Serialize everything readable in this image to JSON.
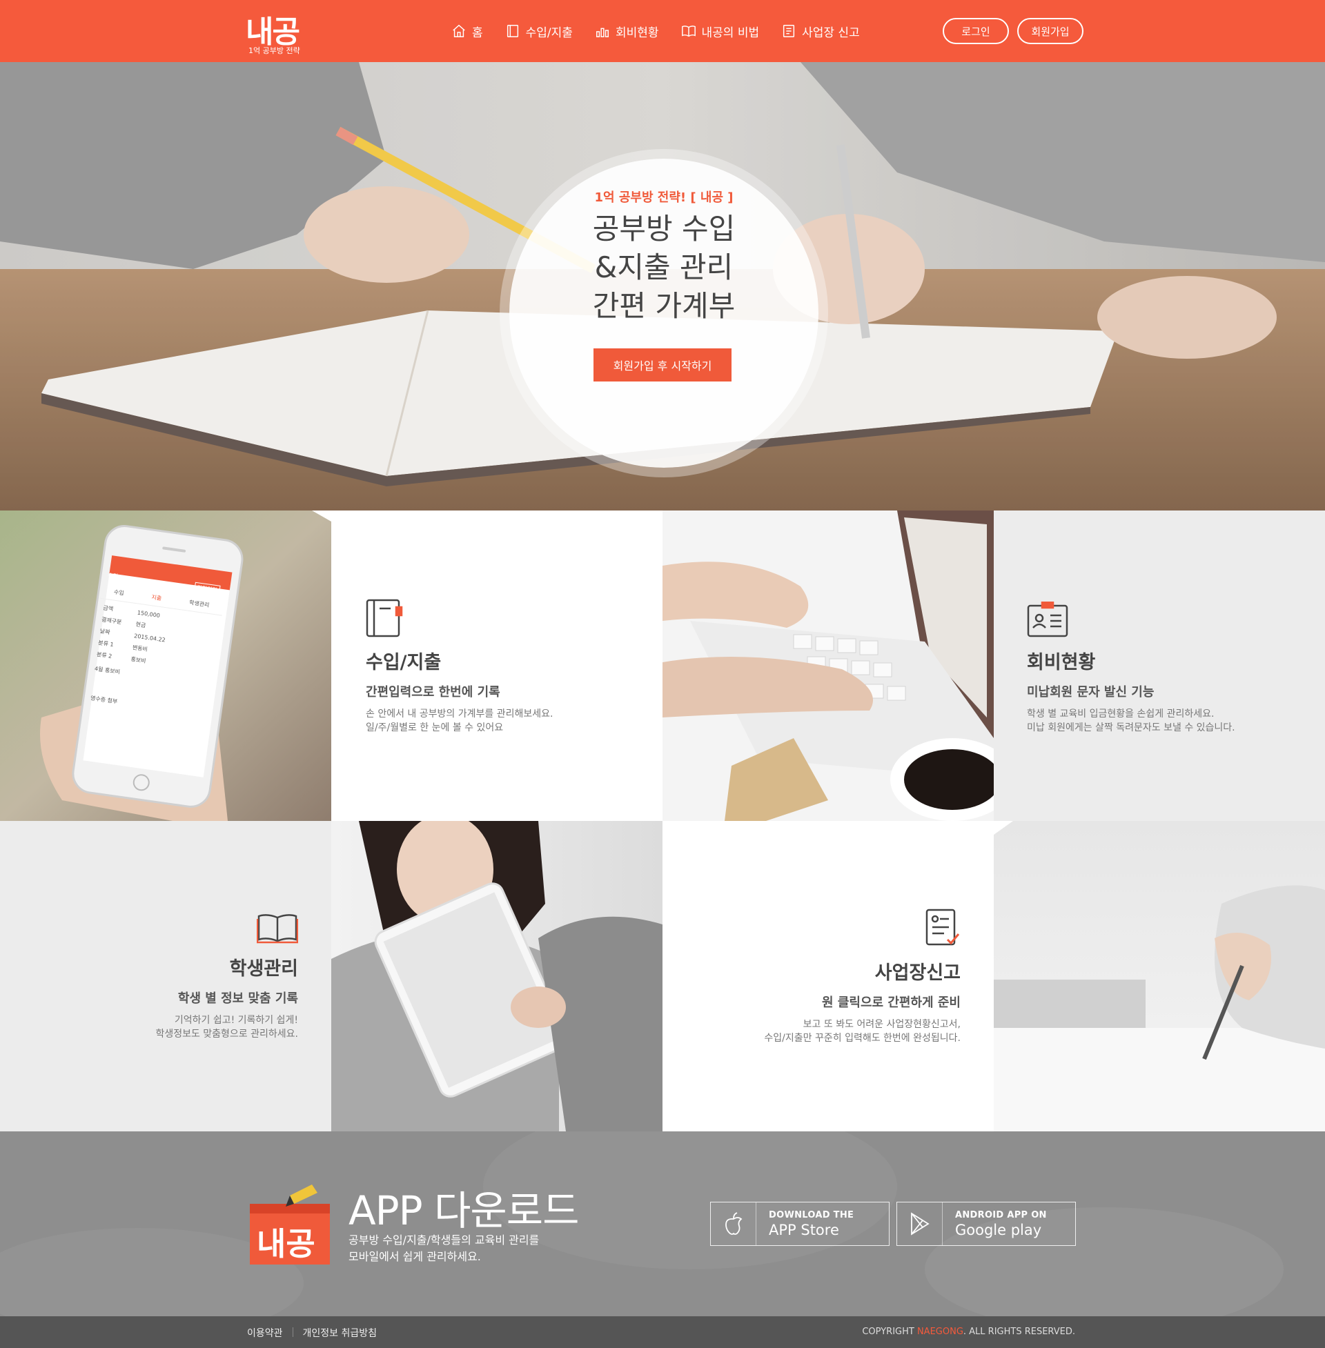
{
  "header": {
    "logo_text": "내공",
    "logo_tagline": "1억 공부방 전략",
    "nav": [
      {
        "label": "홈",
        "icon": "home-icon"
      },
      {
        "label": "수입/지출",
        "icon": "ledger-icon"
      },
      {
        "label": "회비현황",
        "icon": "bar-chart-icon"
      },
      {
        "label": "내공의 비법",
        "icon": "book-icon"
      },
      {
        "label": "사업장 신고",
        "icon": "document-icon"
      }
    ],
    "login_label": "로그인",
    "signup_label": "회원가입",
    "brand_color": "#f55a3c"
  },
  "hero": {
    "tagline": "1억 공부방 전략! [ 내공 ]",
    "title_line1": "공부방 수입",
    "title_line2": "&지출 관리",
    "title_line3": "간편 가계부",
    "cta_label": "회원가입 후 시작하기"
  },
  "features": [
    {
      "title": "수입/지출",
      "subtitle": "간편입력으로 한번에 기록",
      "desc1": "손 안에서 내 공부방의 가계부를 관리해보세요.",
      "desc2": "일/주/월별로 한 눈에 볼 수 있어요",
      "icon": "ledger-icon"
    },
    {
      "title": "회비현황",
      "subtitle": "미납회원 문자 발신 기능",
      "desc1": "학생 별 교육비 입금현황을 손쉽게 관리하세요.",
      "desc2": "미납 회원에게는 살짝 독려문자도 보낼 수 있습니다.",
      "icon": "id-card-icon"
    },
    {
      "title": "학생관리",
      "subtitle": "학생 별 정보 맞춤 기록",
      "desc1": "기억하기 쉽고! 기록하기 쉽게!",
      "desc2": "학생정보도 맞춤형으로 관리하세요.",
      "icon": "open-book-icon"
    },
    {
      "title": "사업장신고",
      "subtitle": "원 클릭으로 간편하게 준비",
      "desc1": "보고 또 봐도 어려운 사업장현황신고서,",
      "desc2": "수입/지출만 꾸준히 입력해도 한번에 완성됩니다.",
      "icon": "checklist-icon"
    }
  ],
  "phone_mockup": {
    "header": "수입",
    "header_btn": "간편입력",
    "tabs": [
      "수입",
      "지출",
      "학생관리"
    ],
    "rows": [
      {
        "label": "금액",
        "value": "150,000"
      },
      {
        "label": "결제구분",
        "value": "현금"
      },
      {
        "label": "날짜",
        "value": "2015.04.22"
      },
      {
        "label": "분류 1",
        "value": "변동비"
      },
      {
        "label": "분류 2",
        "value": "홍보비"
      }
    ],
    "memo": "4월 홍보비",
    "receipt_label": "영수증 첨부"
  },
  "app": {
    "logo_text": "내공",
    "title": "APP 다운로드",
    "desc1": "공부방 수입/지출/학생들의 교육비 관리를",
    "desc2": "모바일에서 쉽게 관리하세요.",
    "appstore_small": "DOWNLOAD THE",
    "appstore_big": "APP Store",
    "google_small": "ANDROID APP ON",
    "google_big": "Google play"
  },
  "footer": {
    "terms": "이용약관",
    "privacy": "개인정보 취급방침",
    "copy_prefix": "COPYRIGHT ",
    "copy_brand": "NAEGONG",
    "copy_suffix": ". ALL RIGHTS RESERVED."
  }
}
